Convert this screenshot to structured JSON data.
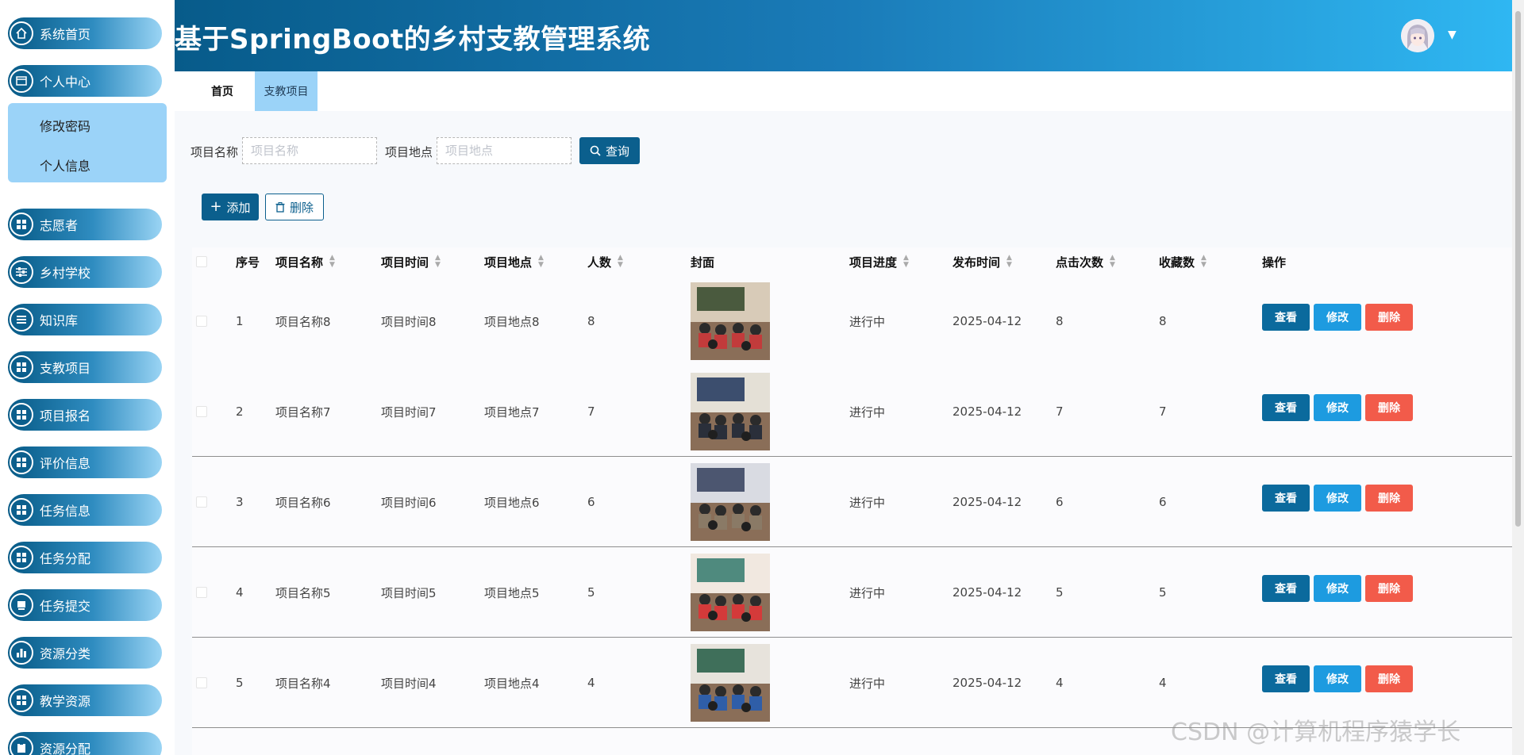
{
  "app": {
    "title": "基于SpringBoot的乡村支教管理系统"
  },
  "sidebar": {
    "items": [
      {
        "label": "系统首页",
        "icon": "home-icon"
      },
      {
        "label": "个人中心",
        "icon": "profile-icon"
      },
      {
        "label": "志愿者",
        "icon": "grid-icon"
      },
      {
        "label": "乡村学校",
        "icon": "sliders-icon"
      },
      {
        "label": "知识库",
        "icon": "list-icon"
      },
      {
        "label": "支教项目",
        "icon": "grid-icon"
      },
      {
        "label": "项目报名",
        "icon": "grid-icon"
      },
      {
        "label": "评价信息",
        "icon": "grid-icon"
      },
      {
        "label": "任务信息",
        "icon": "grid-icon"
      },
      {
        "label": "任务分配",
        "icon": "grid-icon"
      },
      {
        "label": "任务提交",
        "icon": "folder-icon"
      },
      {
        "label": "资源分类",
        "icon": "bar-chart-icon"
      },
      {
        "label": "教学资源",
        "icon": "grid-icon"
      },
      {
        "label": "资源分配",
        "icon": "clipboard-icon"
      }
    ],
    "submenu": [
      {
        "label": "修改密码"
      },
      {
        "label": "个人信息"
      }
    ]
  },
  "tabs": [
    {
      "label": "首页"
    },
    {
      "label": "支教项目"
    }
  ],
  "search": {
    "name_label": "项目名称",
    "name_placeholder": "项目名称",
    "location_label": "项目地点",
    "location_placeholder": "项目地点",
    "query_label": "查询"
  },
  "toolbar": {
    "add_label": "添加",
    "delete_label": "删除"
  },
  "table": {
    "headers": [
      "序号",
      "项目名称",
      "项目时间",
      "项目地点",
      "人数",
      "封面",
      "项目进度",
      "发布时间",
      "点击次数",
      "收藏数",
      "操作"
    ],
    "actions": {
      "view": "查看",
      "edit": "修改",
      "delete": "删除"
    },
    "rows": [
      {
        "index": "1",
        "name": "项目名称8",
        "time": "项目时间8",
        "location": "项目地点8",
        "people": "8",
        "progress": "进行中",
        "published": "2025-04-12",
        "clicks": "8",
        "favorites": "8"
      },
      {
        "index": "2",
        "name": "项目名称7",
        "time": "项目时间7",
        "location": "项目地点7",
        "people": "7",
        "progress": "进行中",
        "published": "2025-04-12",
        "clicks": "7",
        "favorites": "7"
      },
      {
        "index": "3",
        "name": "项目名称6",
        "time": "项目时间6",
        "location": "项目地点6",
        "people": "6",
        "progress": "进行中",
        "published": "2025-04-12",
        "clicks": "6",
        "favorites": "6"
      },
      {
        "index": "4",
        "name": "项目名称5",
        "time": "项目时间5",
        "location": "项目地点5",
        "people": "5",
        "progress": "进行中",
        "published": "2025-04-12",
        "clicks": "5",
        "favorites": "5"
      },
      {
        "index": "5",
        "name": "项目名称4",
        "time": "项目时间4",
        "location": "项目地点4",
        "people": "4",
        "progress": "进行中",
        "published": "2025-04-12",
        "clicks": "4",
        "favorites": "4"
      }
    ]
  },
  "watermark": "CSDN @计算机程序猿学长",
  "colors": {
    "primary": "#0b5f8d",
    "accent_light": "#9bd3f8",
    "edit": "#1d9be0",
    "danger": "#f25b4a"
  }
}
